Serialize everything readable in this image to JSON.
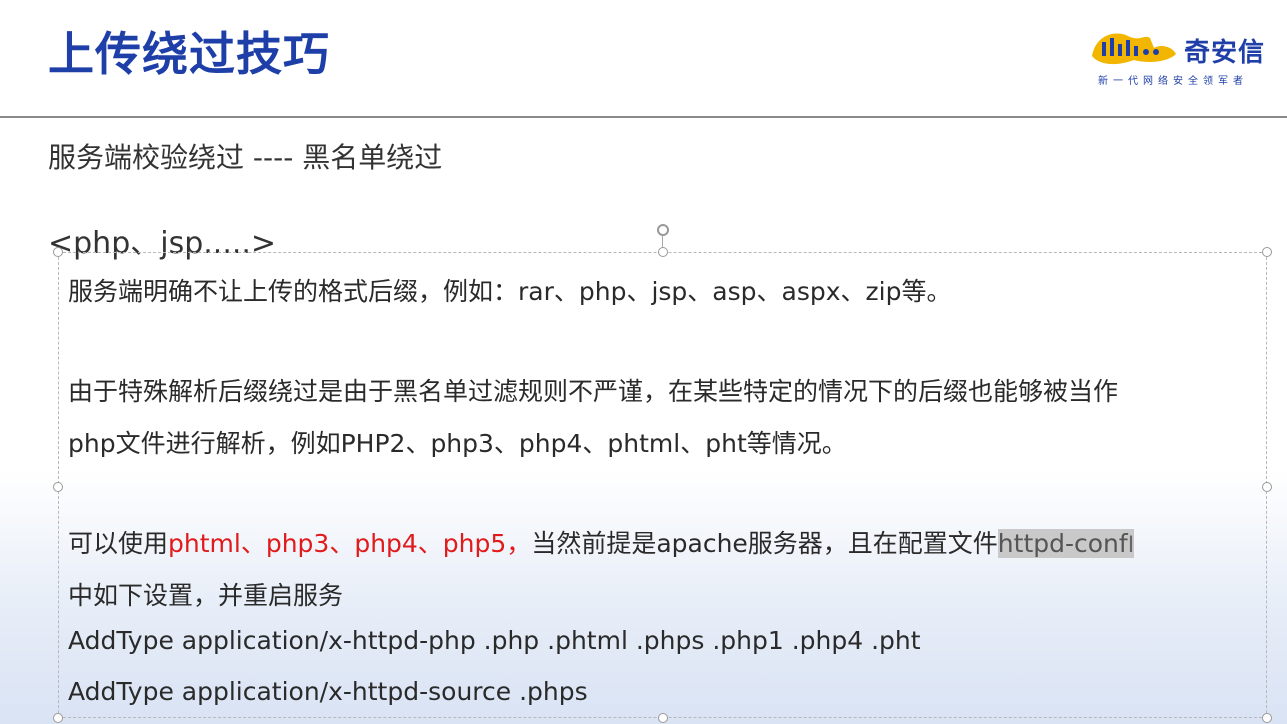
{
  "slide": {
    "title": "上传绕过技巧",
    "subtitle": "服务端校验绕过 ---- 黑名单绕过",
    "tags": "<php、jsp.....>"
  },
  "logo": {
    "name": "奇安信",
    "tagline": "新一代网络安全领军者",
    "icon": "qianxin-logo-icon",
    "brand_color": "#1f3fa8"
  },
  "content": {
    "line1": "服务端明确不让上传的格式后缀，例如：rar、php、jsp、asp、aspx、zip等。",
    "line2": "由于特殊解析后缀绕过是由于黑名单过滤规则不严谨，在某些特定的情况下的后缀也能够被当作",
    "line3": "php文件进行解析，例如PHP2、php3、php4、phtml、pht等情况。",
    "line4_prefix": "可以使用",
    "line4_red": "phtml、php3、php4、php5，",
    "line4_mid": "当然前提是apache服务器，且在配置文件",
    "line4_selected": "httpd-conf",
    "line4_cursor": "I",
    "line5": "中如下设置，并重启服务",
    "line6": "AddType application/x-httpd-php .php .phtml .phps .php1 .php4 .pht",
    "line7": "AddType application/x-httpd-source .phps"
  },
  "colors": {
    "title": "#1f3fa8",
    "highlight": "#e11b1b",
    "selection": "#c9c9c9"
  }
}
